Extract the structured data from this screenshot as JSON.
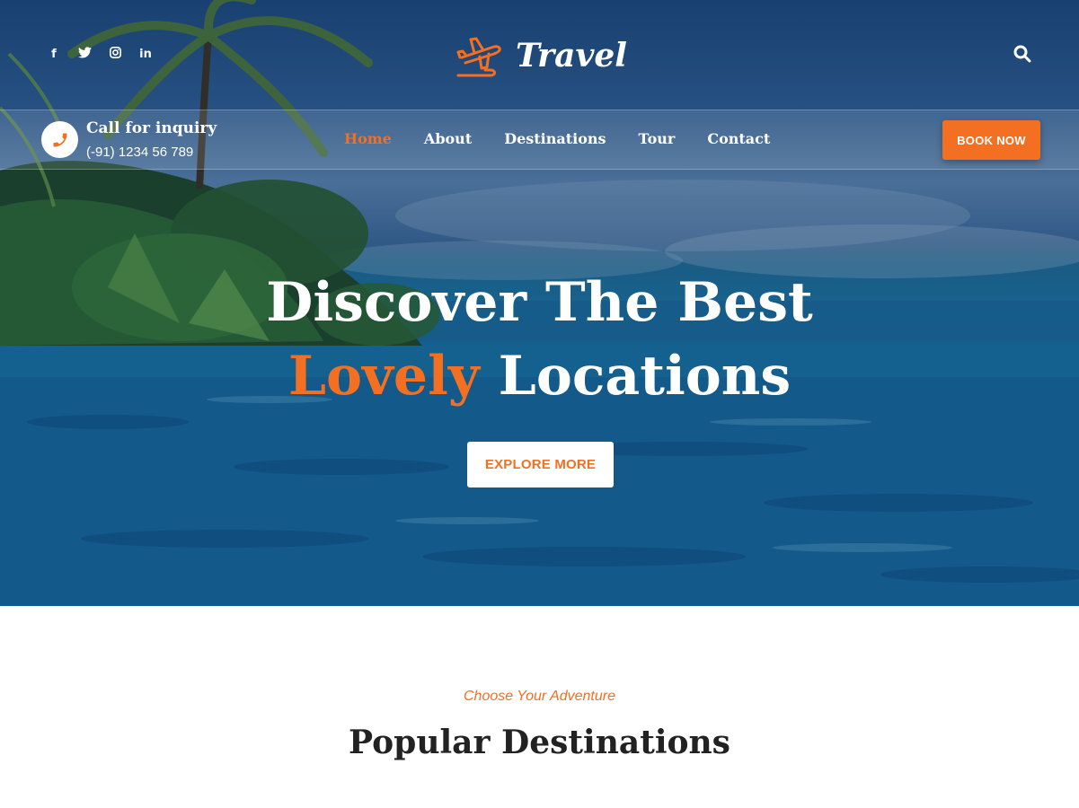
{
  "header": {
    "social": [
      "f",
      "t",
      "ig",
      "in"
    ],
    "logo_text": "Travel",
    "search_icon": "search-icon"
  },
  "nav": {
    "inquiry_title": "Call for inquiry",
    "inquiry_phone": "(-91) 1234 56 789",
    "items": [
      "Home",
      "About",
      "Destinations",
      "Tour",
      "Contact"
    ],
    "active": "Home",
    "book_label": "BOOK NOW"
  },
  "hero": {
    "line1": "Discover The Best",
    "line2_accent": "Lovely",
    "line2_rest": "Locations",
    "button_label": "EXPLORE MORE"
  },
  "section": {
    "subtitle": "Choose Your Adventure",
    "title": "Popular Destinations"
  },
  "colors": {
    "accent": "#f36f21",
    "text_dark": "#222222",
    "white": "#ffffff"
  }
}
